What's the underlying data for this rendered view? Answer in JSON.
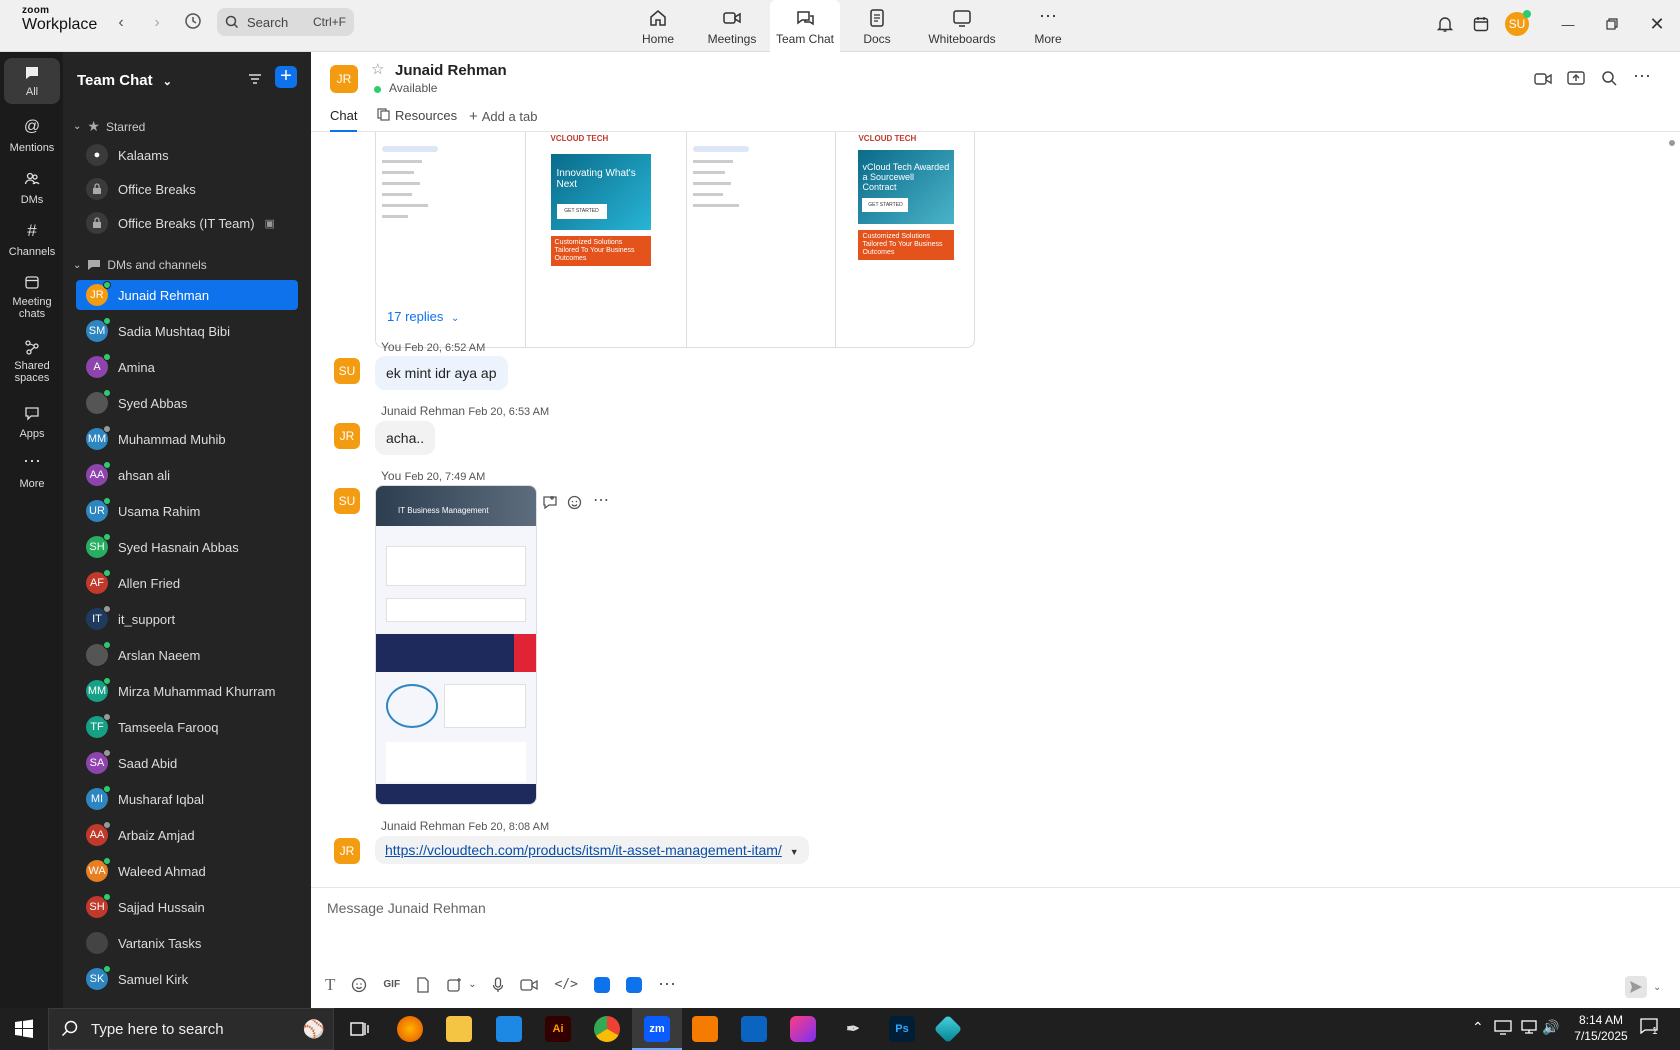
{
  "app": {
    "brand_top": "zoom",
    "brand_bottom": "Workplace"
  },
  "search": {
    "label": "Search",
    "shortcut": "Ctrl+F"
  },
  "tabs": [
    {
      "label": "Home"
    },
    {
      "label": "Meetings"
    },
    {
      "label": "Team Chat"
    },
    {
      "label": "Docs"
    },
    {
      "label": "Whiteboards"
    },
    {
      "label": "More"
    }
  ],
  "user": {
    "initials": "SU"
  },
  "rail": [
    {
      "label": "All"
    },
    {
      "label": "Mentions"
    },
    {
      "label": "DMs"
    },
    {
      "label": "Channels"
    },
    {
      "label": "Meeting chats"
    },
    {
      "label": "Shared spaces"
    },
    {
      "label": "Apps"
    },
    {
      "label": "More"
    }
  ],
  "sidebar": {
    "title": "Team Chat",
    "starred_label": "Starred",
    "starred": [
      {
        "name": "Kalaams"
      },
      {
        "name": "Office Breaks"
      },
      {
        "name": "Office Breaks (IT Team)"
      }
    ],
    "dms_label": "DMs and channels",
    "dms": [
      {
        "initials": "JR",
        "name": "Junaid Rehman",
        "color": "#f39c12",
        "status": "#2ecc71"
      },
      {
        "initials": "SM",
        "name": "Sadia Mushtaq Bibi",
        "color": "#2e86c1",
        "status": "#2ecc71"
      },
      {
        "initials": "A",
        "name": "Amina",
        "color": "#8e44ad",
        "status": "#2ecc71"
      },
      {
        "initials": "",
        "name": "Syed Abbas",
        "color": "#555555",
        "status": "#2ecc71"
      },
      {
        "initials": "MM",
        "name": "Muhammad Muhib",
        "color": "#2e86c1",
        "status": "#999999"
      },
      {
        "initials": "AA",
        "name": "ahsan ali",
        "color": "#8e44ad",
        "status": "#2ecc71"
      },
      {
        "initials": "UR",
        "name": "Usama Rahim",
        "color": "#2e86c1",
        "status": "#2ecc71"
      },
      {
        "initials": "SH",
        "name": "Syed Hasnain Abbas",
        "color": "#27ae60",
        "status": "#2ecc71"
      },
      {
        "initials": "AF",
        "name": "Allen Fried",
        "color": "#c0392b",
        "status": "#2ecc71"
      },
      {
        "initials": "IT",
        "name": "it_support",
        "color": "#1f3a5f",
        "status": "#999999"
      },
      {
        "initials": "",
        "name": "Arslan Naeem",
        "color": "#555555",
        "status": "#2ecc71"
      },
      {
        "initials": "MM",
        "name": "Mirza Muhammad Khurram",
        "color": "#16a085",
        "status": "#2ecc71"
      },
      {
        "initials": "TF",
        "name": "Tamseela Farooq",
        "color": "#16a085",
        "status": "#999999"
      },
      {
        "initials": "SA",
        "name": "Saad Abid",
        "color": "#8e44ad",
        "status": "#999999"
      },
      {
        "initials": "MI",
        "name": "Musharaf Iqbal",
        "color": "#2e86c1",
        "status": "#2ecc71"
      },
      {
        "initials": "AA",
        "name": "Arbaiz Amjad",
        "color": "#c0392b",
        "status": "#999999"
      },
      {
        "initials": "WA",
        "name": "Waleed Ahmad",
        "color": "#e67e22",
        "status": "#2ecc71"
      },
      {
        "initials": "SH",
        "name": "Sajjad Hussain",
        "color": "#c0392b",
        "status": "#2ecc71"
      },
      {
        "initials": "",
        "name": "Vartanix Tasks",
        "color": "#444444",
        "status": ""
      },
      {
        "initials": "SK",
        "name": "Samuel Kirk",
        "color": "#2e86c1",
        "status": "#2ecc71"
      }
    ]
  },
  "chat": {
    "name": "Junaid Rehman",
    "initials": "JR",
    "status": "Available",
    "tabs": [
      {
        "label": "Chat"
      },
      {
        "label": "Resources"
      },
      {
        "label": "Add a tab"
      }
    ],
    "replies": "17 replies",
    "messages": [
      {
        "initials": "SU",
        "sender": "You",
        "time": "Feb 20, 6:52 AM",
        "text": "ek mint idr aya ap"
      },
      {
        "initials": "JR",
        "sender": "Junaid Rehman",
        "time": "Feb 20, 6:53 AM",
        "text": "acha.."
      },
      {
        "initials": "SU",
        "sender": "You",
        "time": "Feb 20, 7:49 AM",
        "text": ""
      },
      {
        "initials": "JR",
        "sender": "Junaid Rehman",
        "time": "Feb 20, 8:08 AM",
        "text": "https://vcloudtech.com/products/itsm/it-asset-management-itam/"
      }
    ],
    "thumb1": {
      "brand": "VCLOUD TECH",
      "headline": "Innovating What's Next",
      "cta": "GET STARTED",
      "banner": "Customized Solutions Tailored To Your Business Outcomes"
    },
    "thumb2": {
      "brand": "VCLOUD TECH",
      "headline": "vCloud Tech Awarded a Sourcewell Contract",
      "cta": "GET STARTED",
      "banner": "Customized Solutions Tailored To Your Business Outcomes"
    },
    "thumb3": {
      "headline": "IT Business Management"
    }
  },
  "composer": {
    "placeholder": "Message Junaid Rehman",
    "gif": "GIF"
  },
  "taskbar": {
    "search": "Type here to search",
    "time": "8:14 AM",
    "date": "7/15/2025",
    "notif": "1",
    "zm": "zm",
    "ai": "Ai",
    "ps": "Ps"
  }
}
